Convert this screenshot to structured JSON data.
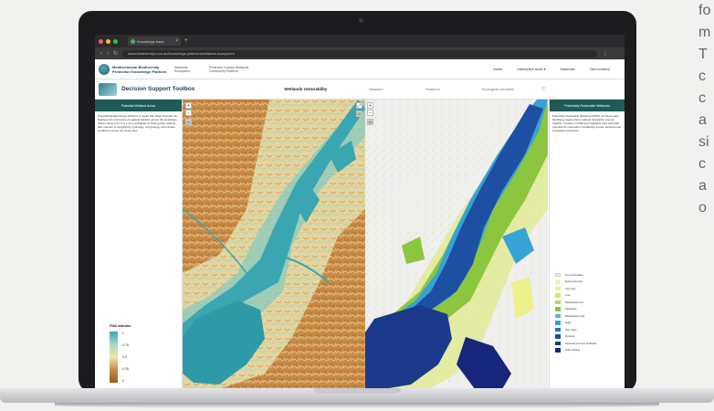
{
  "side_text": [
    "fo",
    "m",
    "",
    "T",
    "c",
    "c",
    "a",
    "si",
    "c",
    "a",
    "o"
  ],
  "browser": {
    "tab_title": "Knowledge base",
    "tab_close": "×",
    "new_tab": "+",
    "url": "www.biodiversity.com.au/knowledge-platform/wetlands-ecosystem",
    "back": "‹",
    "forward": "›",
    "reload": "↻",
    "menu": "⋮"
  },
  "site_header": {
    "brand": "Mediterranean Biodiversity Protection Knowledge Platform",
    "sub1": "Wetlands Ecosystem",
    "sub2": "Protected Coastal Wetlands Community Platform",
    "nav": [
      "Home",
      "Interactive tools ▾",
      "Materials",
      "Get involved"
    ]
  },
  "toolbox": {
    "title": "Decision Support Toolbox",
    "center": "Wetlands restorability",
    "options": [
      "Measure",
      "Features",
      "Ecological variables"
    ],
    "filter_icon": "▽"
  },
  "left_panel": {
    "title": "Potential Wetland Areas",
    "body": "Potential Wetland Areas (PWA) is a model that helps estimate the likelihood of occurrence of wetland habitats across the landscape. Values range from 0 to 1 as a probability of hosting high wetland flats relevant to topography, hydrology, soil geology, and climate conditions across the study area.",
    "legend_title": "PWA indicator",
    "legend_ticks": [
      "1",
      "0.75",
      "0.5",
      "0.25",
      "0"
    ]
  },
  "right_panel": {
    "title": "Potentially Restorable Wetlands",
    "body": "Potentially Restorable Wetlands (PRW) combines data identifying areas where wetland restoration may be feasible. It builds on PWA and highlights sites with high potential for restoration considering current land-use and ecological constraints.",
    "legend": [
      {
        "label": "Non restorable",
        "color": "#f2f2f2"
      },
      {
        "label": "Extremely low",
        "color": "#f7f1a6"
      },
      {
        "label": "Very low",
        "color": "#eef08a"
      },
      {
        "label": "Low",
        "color": "#d8e868"
      },
      {
        "label": "Moderately low",
        "color": "#b6d94f"
      },
      {
        "label": "Moderate",
        "color": "#8cc63f"
      },
      {
        "label": "Moderately high",
        "color": "#5cb8c4"
      },
      {
        "label": "High",
        "color": "#36a3d4"
      },
      {
        "label": "Very high",
        "color": "#2a74c0"
      },
      {
        "label": "Optimal",
        "color": "#1d4fa3"
      },
      {
        "label": "Optimal (Current wetland)",
        "color": "#1b3a8a"
      },
      {
        "label": "Still existing",
        "color": "#16267a"
      }
    ]
  },
  "map_controls": {
    "zoom_in": "+",
    "zoom_out": "−",
    "layers": "▤",
    "fullscreen": "⤢"
  },
  "colors": {
    "header_green": "#1e5b55",
    "water": "#2f9aa7",
    "deep_water": "#1f2f8a"
  }
}
